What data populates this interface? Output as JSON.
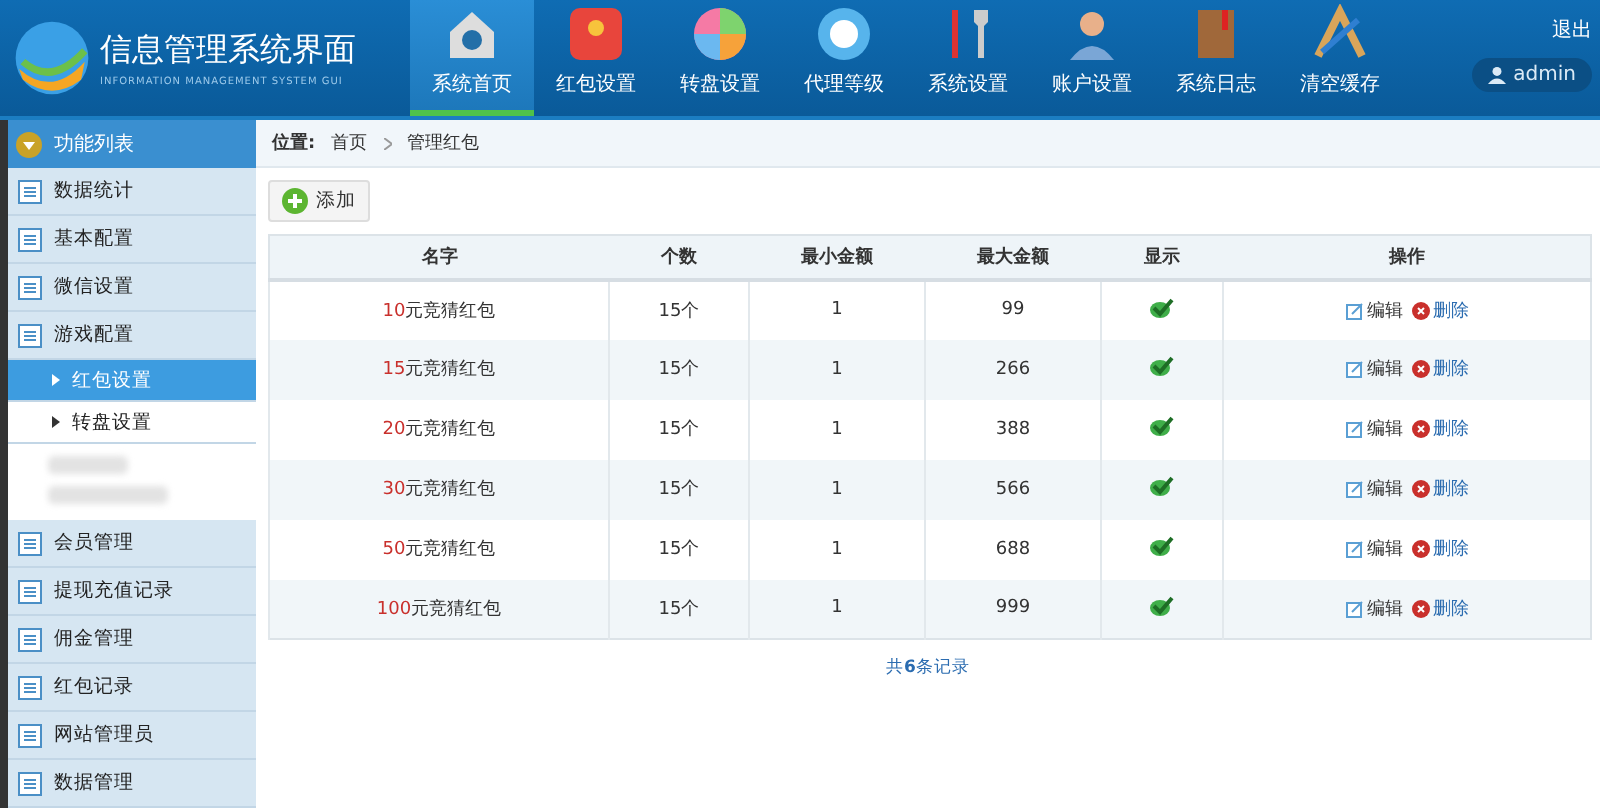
{
  "header": {
    "title": "信息管理系统界面",
    "subtitle": "INFORMATION MANAGEMENT SYSTEM GUI",
    "logout": "退出",
    "user": "admin"
  },
  "nav": [
    {
      "label": "系统首页",
      "kind": "house",
      "selected": true
    },
    {
      "label": "红包设置",
      "kind": "envelope",
      "selected": false
    },
    {
      "label": "转盘设置",
      "kind": "wheel",
      "selected": false
    },
    {
      "label": "代理等级",
      "kind": "coin",
      "selected": false
    },
    {
      "label": "系统设置",
      "kind": "tools",
      "selected": false
    },
    {
      "label": "账户设置",
      "kind": "person",
      "selected": false
    },
    {
      "label": "系统日志",
      "kind": "book",
      "selected": false
    },
    {
      "label": "清空缓存",
      "kind": "ruler",
      "selected": false
    }
  ],
  "sidebar": {
    "title": "功能列表",
    "items": [
      {
        "kind": "group",
        "label": "数据统计",
        "selected": false
      },
      {
        "kind": "group",
        "label": "基本配置",
        "selected": false
      },
      {
        "kind": "group",
        "label": "微信设置",
        "selected": false
      },
      {
        "kind": "group",
        "label": "游戏配置",
        "selected": false
      },
      {
        "kind": "sub",
        "label": "红包设置",
        "selected": true
      },
      {
        "kind": "sub",
        "label": "转盘设置",
        "selected": false
      },
      {
        "kind": "blurred"
      },
      {
        "kind": "group",
        "label": "会员管理",
        "selected": false
      },
      {
        "kind": "group",
        "label": "提现充值记录",
        "selected": false
      },
      {
        "kind": "group",
        "label": "佣金管理",
        "selected": false
      },
      {
        "kind": "group",
        "label": "红包记录",
        "selected": false
      },
      {
        "kind": "group",
        "label": "网站管理员",
        "selected": false
      },
      {
        "kind": "group",
        "label": "数据管理",
        "selected": false
      }
    ]
  },
  "breadcrumb": {
    "label": "位置:",
    "items": [
      "首页",
      "管理红包"
    ]
  },
  "add_button": "添加",
  "table": {
    "columns": [
      "名字",
      "个数",
      "最小金额",
      "最大金额",
      "显示",
      "操作"
    ],
    "rows": [
      {
        "amount": "10",
        "name": "元竞猜红包",
        "count": "15个",
        "min": "1",
        "max": "99",
        "shown": true,
        "edit": "编辑",
        "delete": "删除"
      },
      {
        "amount": "15",
        "name": "元竞猜红包",
        "count": "15个",
        "min": "1",
        "max": "266",
        "shown": true,
        "edit": "编辑",
        "delete": "删除"
      },
      {
        "amount": "20",
        "name": "元竞猜红包",
        "count": "15个",
        "min": "1",
        "max": "388",
        "shown": true,
        "edit": "编辑",
        "delete": "删除"
      },
      {
        "amount": "30",
        "name": "元竞猜红包",
        "count": "15个",
        "min": "1",
        "max": "566",
        "shown": true,
        "edit": "编辑",
        "delete": "删除"
      },
      {
        "amount": "50",
        "name": "元竞猜红包",
        "count": "15个",
        "min": "1",
        "max": "688",
        "shown": true,
        "edit": "编辑",
        "delete": "删除"
      },
      {
        "amount": "100",
        "name": "元竞猜红包",
        "count": "15个",
        "min": "1",
        "max": "999",
        "shown": true,
        "edit": "编辑",
        "delete": "删除"
      }
    ]
  },
  "footer": "共**6**条记录"
}
